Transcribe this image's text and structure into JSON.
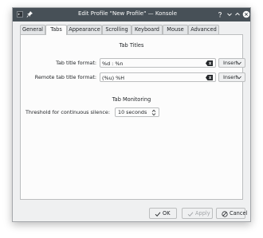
{
  "window": {
    "title": "Edit Profile \"New Profile\" — Konsole"
  },
  "tabs": [
    {
      "label": "General"
    },
    {
      "label": "Tabs"
    },
    {
      "label": "Appearance"
    },
    {
      "label": "Scrolling"
    },
    {
      "label": "Keyboard"
    },
    {
      "label": "Mouse"
    },
    {
      "label": "Advanced"
    }
  ],
  "active_tab": "Tabs",
  "tab_titles": {
    "heading": "Tab Titles",
    "tab_title_format": {
      "label": "Tab title format:",
      "value": "%d : %n",
      "insert_label": "Insert"
    },
    "remote_tab_title_format": {
      "label": "Remote tab title format:",
      "value": "(%u) %H",
      "insert_label": "Insert"
    }
  },
  "tab_monitoring": {
    "heading": "Tab Monitoring",
    "silence_label": "Threshold for continuous silence:",
    "silence_value": "10 seconds"
  },
  "buttons": {
    "ok": "OK",
    "apply": "Apply",
    "cancel": "Cancel"
  },
  "icons": {
    "app": "konsole-icon",
    "pin": "pin-icon",
    "help": "question-icon",
    "minimize": "chevron-down-icon",
    "maximize": "chevron-up-icon",
    "close": "close-icon"
  },
  "colors": {
    "titlebar": "#475057",
    "window_bg": "#eff0f1",
    "panel_bg": "#fcfcfc",
    "border": "#bcbebf",
    "text": "#232629",
    "disabled_text": "#a0a3a6"
  }
}
